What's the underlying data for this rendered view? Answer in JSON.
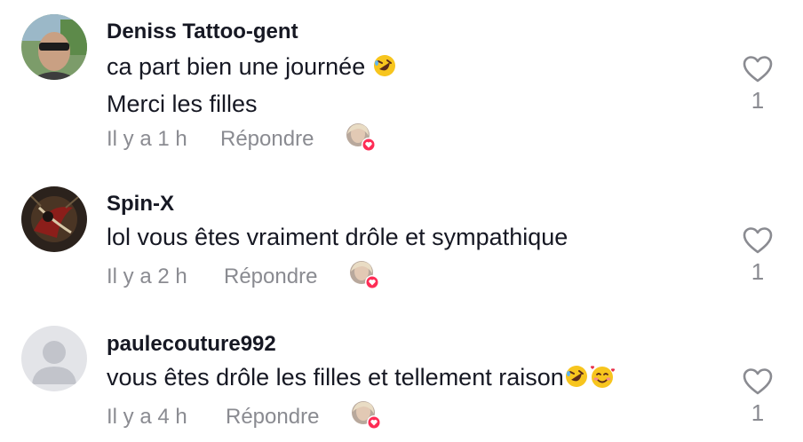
{
  "comments": [
    {
      "username": "Deniss Tattoo-gent",
      "lines": [
        "ca part bien une journée",
        "Merci les filles"
      ],
      "emoji_names": [
        "rofl-emoji"
      ],
      "time": "Il y a 1 h",
      "reply_label": "Répondre",
      "likes": "1"
    },
    {
      "username": "Spin-X",
      "lines": [
        "lol vous êtes vraiment drôle et sympathique"
      ],
      "emoji_names": [],
      "time": "Il y a 2 h",
      "reply_label": "Répondre",
      "likes": "1"
    },
    {
      "username": "paulecouture992",
      "lines": [
        "vous êtes drôle les filles et tellement raison"
      ],
      "emoji_names": [
        "rofl-emoji",
        "smiling-face-with-hearts-emoji"
      ],
      "time": "Il y a 4 h",
      "reply_label": "Répondre",
      "likes": "1"
    }
  ],
  "colors": {
    "text": "#161823",
    "muted": "#8a8b91",
    "creator_heart_badge": "#fe2c55"
  },
  "icons": {
    "like": "heart-outline-icon",
    "creator_liked": "creator-liked-badge-icon"
  }
}
